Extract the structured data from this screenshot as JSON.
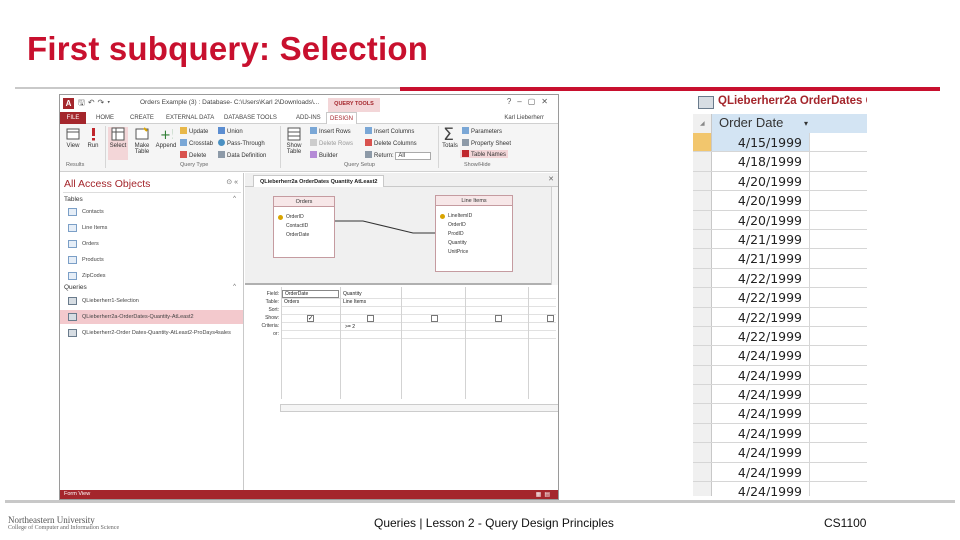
{
  "slide": {
    "title": "First subquery: Selection",
    "footer_center": "Queries | Lesson 2 - Query Design Principles",
    "footer_right": "CS1100",
    "logo_name": "Northeastern University",
    "logo_sub": "College of Computer and Information Science",
    "accent_color": "#c8102e"
  },
  "access": {
    "window_title": "Orders Example (3) : Database- C:\\Users\\Karl 2\\Downloads\\...",
    "contextual_tab": "QUERY TOOLS",
    "user": "Karl Lieberherr",
    "ribbon_tabs": [
      "FILE",
      "HOME",
      "CREATE",
      "EXTERNAL DATA",
      "DATABASE TOOLS",
      "ADD-INS",
      "DESIGN"
    ],
    "ribbon": {
      "view": "View",
      "run": "Run",
      "select": "Select",
      "make_table": "Make Table",
      "append": "Append",
      "update": "Update",
      "union": "Union",
      "crosstab": "Crosstab",
      "pass_through": "Pass-Through",
      "delete": "Delete",
      "data_definition": "Data Definition",
      "show_table": "Show Table",
      "insert_rows": "Insert Rows",
      "delete_rows": "Delete Rows",
      "builder": "Builder",
      "insert_columns": "Insert Columns",
      "delete_columns": "Delete Columns",
      "return": "Return:",
      "return_value": "All",
      "totals": "Totals",
      "parameters": "Parameters",
      "property_sheet": "Property Sheet",
      "table_names": "Table Names",
      "group_results": "Results",
      "group_query_type": "Query Type",
      "group_query_setup": "Query Setup",
      "group_show_hide": "Show/Hide"
    },
    "nav": {
      "title": "All Access Objects",
      "tables_header": "Tables",
      "tables": [
        "Contacts",
        "Line Items",
        "Orders",
        "Products",
        "ZipCodes"
      ],
      "queries_header": "Queries",
      "queries": [
        "QLieberherr1-Selection",
        "QLieberherr2a-OrderDates-Quantity-AtLeast2",
        "QLieberherr2-Order Dates-Quantity-AtLeast2-ProDays4sales"
      ]
    },
    "doc_tab": "QLieberherr2a OrderDates Quantity AtLeast2",
    "tables": {
      "orders": {
        "name": "Orders",
        "fields": [
          "OrderID",
          "ContactID",
          "OrderDate"
        ]
      },
      "line_items": {
        "name": "Line Items",
        "fields": [
          "LineItemID",
          "OrderID",
          "ProdID",
          "Quantity",
          "UnitPrice"
        ]
      }
    },
    "qbe": {
      "row_labels": [
        "Field:",
        "Table:",
        "Sort:",
        "Show:",
        "Criteria:",
        "or:"
      ],
      "col1_field": "OrderDate",
      "col1_table": "Orders",
      "col2_field": "Quantity",
      "col2_table": "Line Items",
      "col2_criteria": ">= 2"
    },
    "status": "Form View"
  },
  "datasheet": {
    "tab_label": "QLieberherr2a OrderDates Q",
    "column": "Order Date",
    "rows": [
      "4/15/1999",
      "4/18/1999",
      "4/20/1999",
      "4/20/1999",
      "4/20/1999",
      "4/21/1999",
      "4/21/1999",
      "4/22/1999",
      "4/22/1999",
      "4/22/1999",
      "4/22/1999",
      "4/24/1999",
      "4/24/1999",
      "4/24/1999",
      "4/24/1999",
      "4/24/1999",
      "4/24/1999",
      "4/24/1999",
      "4/24/1999"
    ],
    "selected_row": 0
  }
}
